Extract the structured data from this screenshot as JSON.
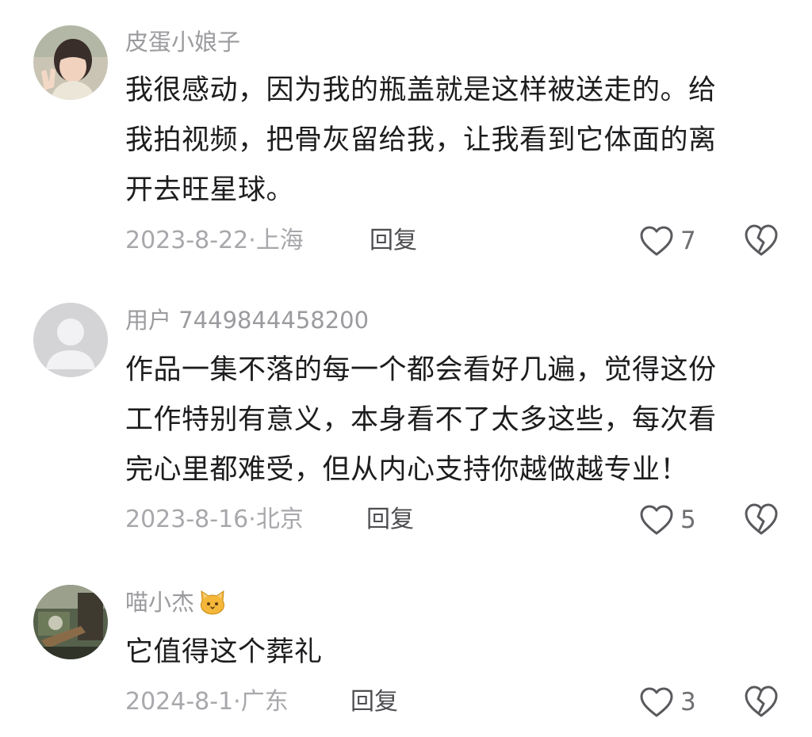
{
  "comments": [
    {
      "username": "皮蛋小娘子",
      "avatar": "photo-avatar",
      "lines": [
        "我很感动，因为我的瓶盖就是这样被送走的。给",
        "我拍视频，把骨灰留给我，让我看到它体面的离",
        "开去旺星球。"
      ],
      "date": "2023-8-22",
      "location": "上海",
      "reply_label": "回复",
      "like_count": "7"
    },
    {
      "username": "用户 7449844458200",
      "avatar": "default-avatar",
      "lines": [
        "作品一集不落的每一个都会看好几遍，觉得这份",
        "工作特别有意义，本身看不了太多这些，每次看",
        "完心里都难受，但从内心支持你越做越专业！"
      ],
      "date": "2023-8-16",
      "location": "北京",
      "reply_label": "回复",
      "like_count": "5"
    },
    {
      "username": "喵小杰",
      "username_emoji": "cat-face-emoji",
      "avatar": "photo-avatar",
      "lines": [
        "它值得这个葬礼"
      ],
      "date": "2024-8-1",
      "location": "广东",
      "reply_label": "回复",
      "like_count": "3"
    }
  ],
  "icons": {
    "like": "heart-outline-icon",
    "dislike": "broken-heart-icon"
  },
  "colors": {
    "username": "#9b9b9f",
    "content": "#1d1d1f",
    "meta": "#a8a8ac",
    "reply": "#4e4e52",
    "icon": "#5a5a5e"
  }
}
